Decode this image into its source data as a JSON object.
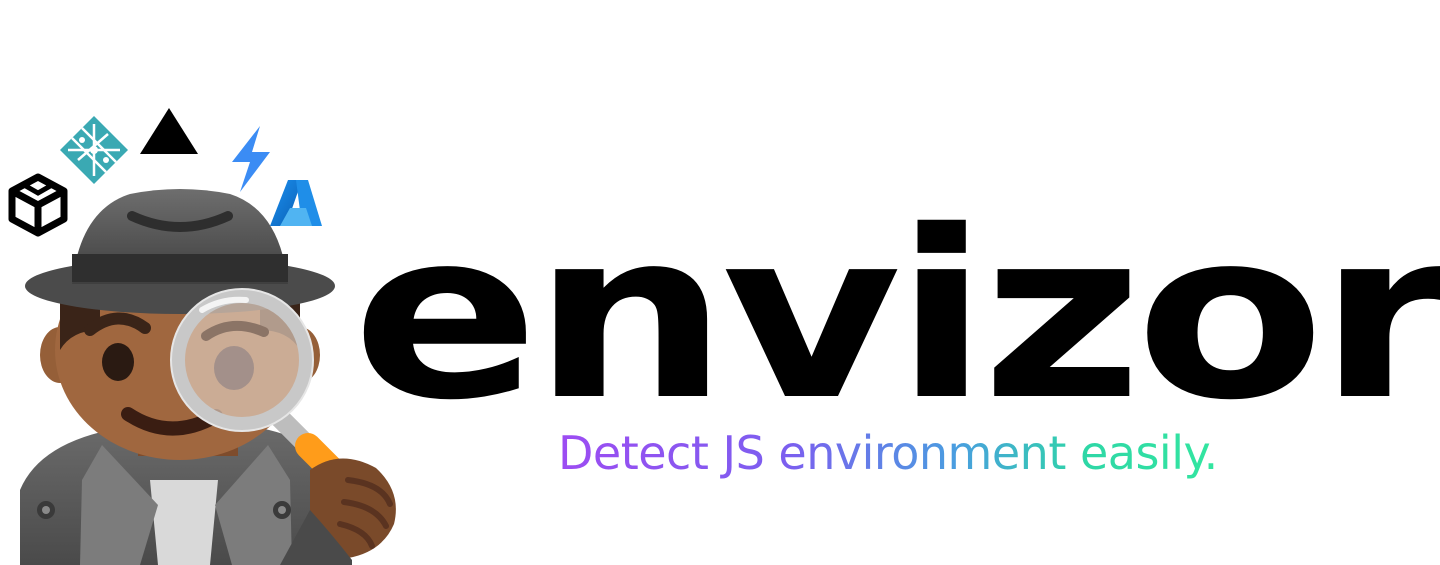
{
  "brand": {
    "name": "envizor",
    "tagline": "Detect JS environment easily."
  },
  "colors": {
    "wordmark": "#000000",
    "tagline_gradient_start": "#9d4cf2",
    "tagline_gradient_end": "#33e6a0",
    "netlify_teal": "#3aa9b3",
    "bolt_blue": "#3b8cf4",
    "azure_blue": "#0a78d4",
    "hat_grey": "#5a5a5a",
    "skin_brown": "#a0673f",
    "lens_handle_orange": "#ff9c1a"
  },
  "icons": {
    "codesandbox": "codesandbox-icon",
    "netlify": "netlify-icon",
    "vercel": "vercel-icon",
    "bolt": "lightning-bolt-icon",
    "azure": "azure-icon",
    "mascot": "detective-icon",
    "magnifier": "magnifying-glass-icon"
  }
}
